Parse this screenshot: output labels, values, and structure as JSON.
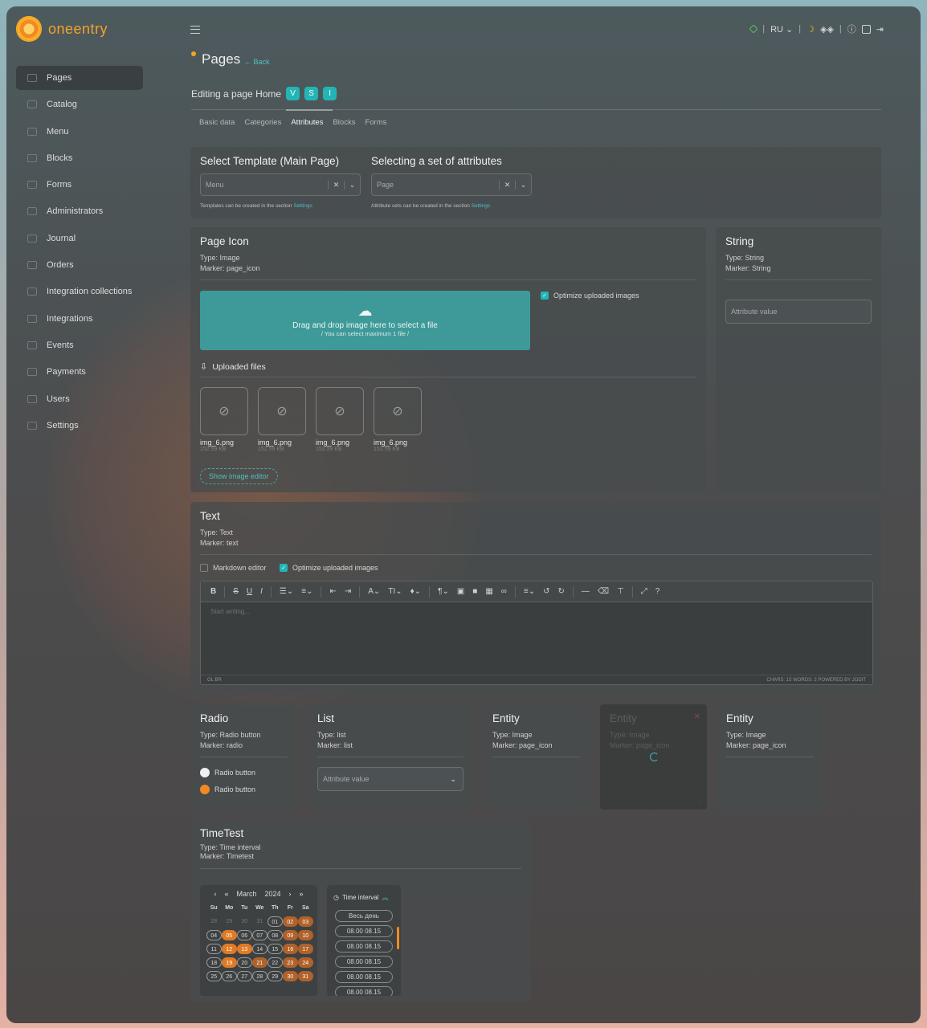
{
  "brand": {
    "name": "oneentry"
  },
  "topbar": {
    "lang": "RU"
  },
  "sidebar": {
    "items": [
      {
        "label": "Pages",
        "icon": "sliders-icon"
      },
      {
        "label": "Catalog",
        "icon": "list-icon"
      },
      {
        "label": "Menu",
        "icon": "menu-icon"
      },
      {
        "label": "Blocks",
        "icon": "blocks-icon"
      },
      {
        "label": "Forms",
        "icon": "forms-icon"
      },
      {
        "label": "Administrators",
        "icon": "key-icon"
      },
      {
        "label": "Journal",
        "icon": "journal-icon"
      },
      {
        "label": "Orders",
        "icon": "orders-icon"
      },
      {
        "label": "Integration collections",
        "icon": "link-icon"
      },
      {
        "label": "Integrations",
        "icon": "link-icon"
      },
      {
        "label": "Events",
        "icon": "calendar-icon"
      },
      {
        "label": "Payments",
        "icon": "card-icon"
      },
      {
        "label": "Users",
        "icon": "users-icon"
      },
      {
        "label": "Settings",
        "icon": "gear-icon"
      }
    ]
  },
  "header": {
    "title": "Pages",
    "back": "Back",
    "editing": "Editing a page Home",
    "chips": [
      "V",
      "S",
      "I"
    ]
  },
  "tabs": [
    "Basic data",
    "Categories",
    "Attributes",
    "Blocks",
    "Forms"
  ],
  "template_card": {
    "template_title": "Select Template (Main Page)",
    "template_value": "Menu",
    "template_hint": "Templates can be created in the section",
    "template_link": "Settings",
    "attrs_title": "Selecting a set of attributes",
    "attrs_value": "Page",
    "attrs_hint": "Attribute sets can be created in the section",
    "attrs_link": "Settings"
  },
  "page_icon": {
    "title": "Page Icon",
    "type": "Type: Image",
    "marker": "Marker: page_icon",
    "drop_text": "Drag and drop image here to select a file",
    "drop_sub": "/ You can select maximum 1 file /",
    "optimize": "Optimize uploaded images",
    "uploaded": "Uploaded files",
    "files": [
      {
        "name": "img_6.png",
        "size": "152.59 KB"
      },
      {
        "name": "img_6.png",
        "size": "152.59 KB"
      },
      {
        "name": "img_6.png",
        "size": "152.59 KB"
      },
      {
        "name": "img_6.png",
        "size": "152.59 KB"
      }
    ],
    "editor_btn": "Show image editor"
  },
  "string_card": {
    "title": "String",
    "type": "Type: String",
    "marker": "Marker: String",
    "placeholder": "Attribute value"
  },
  "text_card": {
    "title": "Text",
    "type": "Type: Text",
    "marker": "Marker: text",
    "markdown": "Markdown editor",
    "optimize": "Optimize uploaded images",
    "placeholder": "Start writing...",
    "foot_left": "OL  BR",
    "foot_right": "CHARS: 15   WORDS: 2   POWERED BY JODIT"
  },
  "radio_card": {
    "title": "Radio",
    "type": "Type: Radio button",
    "marker": "Marker: radio",
    "options": [
      "Radio button",
      "Radio button"
    ]
  },
  "list_card": {
    "title": "List",
    "type": "Type: list",
    "marker": "Marker: list",
    "placeholder": "Attribute value"
  },
  "entity_card_1": {
    "title": "Entity",
    "type": "Type: Image",
    "marker": "Marker: page_icon"
  },
  "entity_card_2": {
    "title": "Entity",
    "type": "Type: Image",
    "marker": "Marker: page_icon"
  },
  "entity_card_3": {
    "title": "Entity",
    "type": "Type: Image",
    "marker": "Marker: page_icon"
  },
  "timetest": {
    "title": "TimeTest",
    "type": "Type: Time interval",
    "marker": "Marker: Timetest",
    "month": "March",
    "year": "2024",
    "weekdays": [
      "Su",
      "Mo",
      "Tu",
      "We",
      "Th",
      "Fr",
      "Sa"
    ],
    "days": [
      {
        "d": "28",
        "s": "muted"
      },
      {
        "d": "29",
        "s": "muted"
      },
      {
        "d": "30",
        "s": "muted"
      },
      {
        "d": "31",
        "s": "muted"
      },
      {
        "d": "01",
        "s": "ring"
      },
      {
        "d": "02",
        "s": "br"
      },
      {
        "d": "03",
        "s": "br"
      },
      {
        "d": "04",
        "s": "ring"
      },
      {
        "d": "05",
        "s": "or"
      },
      {
        "d": "06",
        "s": "ring"
      },
      {
        "d": "07",
        "s": "ring"
      },
      {
        "d": "08",
        "s": "ring"
      },
      {
        "d": "09",
        "s": "br"
      },
      {
        "d": "10",
        "s": "br"
      },
      {
        "d": "11",
        "s": "ring"
      },
      {
        "d": "12",
        "s": "or"
      },
      {
        "d": "13",
        "s": "or"
      },
      {
        "d": "14",
        "s": "ring"
      },
      {
        "d": "15",
        "s": "ring"
      },
      {
        "d": "16",
        "s": "br"
      },
      {
        "d": "17",
        "s": "br"
      },
      {
        "d": "18",
        "s": "ring"
      },
      {
        "d": "19",
        "s": "or"
      },
      {
        "d": "20",
        "s": "ring"
      },
      {
        "d": "21",
        "s": "br"
      },
      {
        "d": "22",
        "s": "ring"
      },
      {
        "d": "23",
        "s": "br"
      },
      {
        "d": "24",
        "s": "br"
      },
      {
        "d": "25",
        "s": "ring"
      },
      {
        "d": "26",
        "s": "ring"
      },
      {
        "d": "27",
        "s": "ring"
      },
      {
        "d": "28",
        "s": "ring"
      },
      {
        "d": "29",
        "s": "ring"
      },
      {
        "d": "30",
        "s": "br"
      },
      {
        "d": "31",
        "s": "br"
      }
    ],
    "interval_title": "Time interval",
    "all_day": "Весь день",
    "slots": [
      "08.00  08.15",
      "08.00  08.15",
      "08.00  08.15",
      "08.00  08.15",
      "08.00  08.15"
    ]
  },
  "colors": {
    "accent": "#23b5b5",
    "orange": "#f28a22"
  }
}
